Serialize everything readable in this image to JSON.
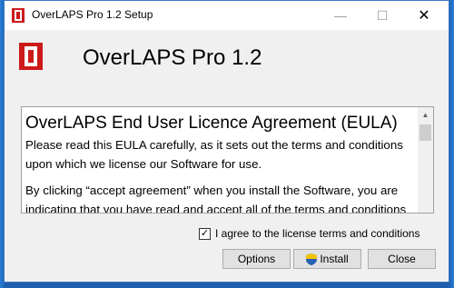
{
  "window": {
    "title": "OverLAPS Pro 1.2 Setup",
    "minimize_glyph": "—",
    "maximize_glyph": "☐",
    "close_glyph": "✕"
  },
  "header": {
    "heading": "OverLAPS Pro 1.2",
    "icon": "overlaps-app-icon",
    "brand_color": "#cc1a1a"
  },
  "eula": {
    "title": "OverLAPS End User Licence Agreement (EULA)",
    "paragraphs": [
      "Please read this EULA carefully, as it sets out the terms and conditions upon which we license our Software for use.",
      "By clicking “accept agreement” when you install the Software, you are indicating that you have read and accept all of the terms and conditions of this EULA. If"
    ]
  },
  "agreement": {
    "checked": true,
    "check_glyph": "✓",
    "label": "I agree to the license terms and conditions"
  },
  "buttons": {
    "options": "Options",
    "install": "Install",
    "close": "Close",
    "install_icon": "uac-shield-icon"
  }
}
